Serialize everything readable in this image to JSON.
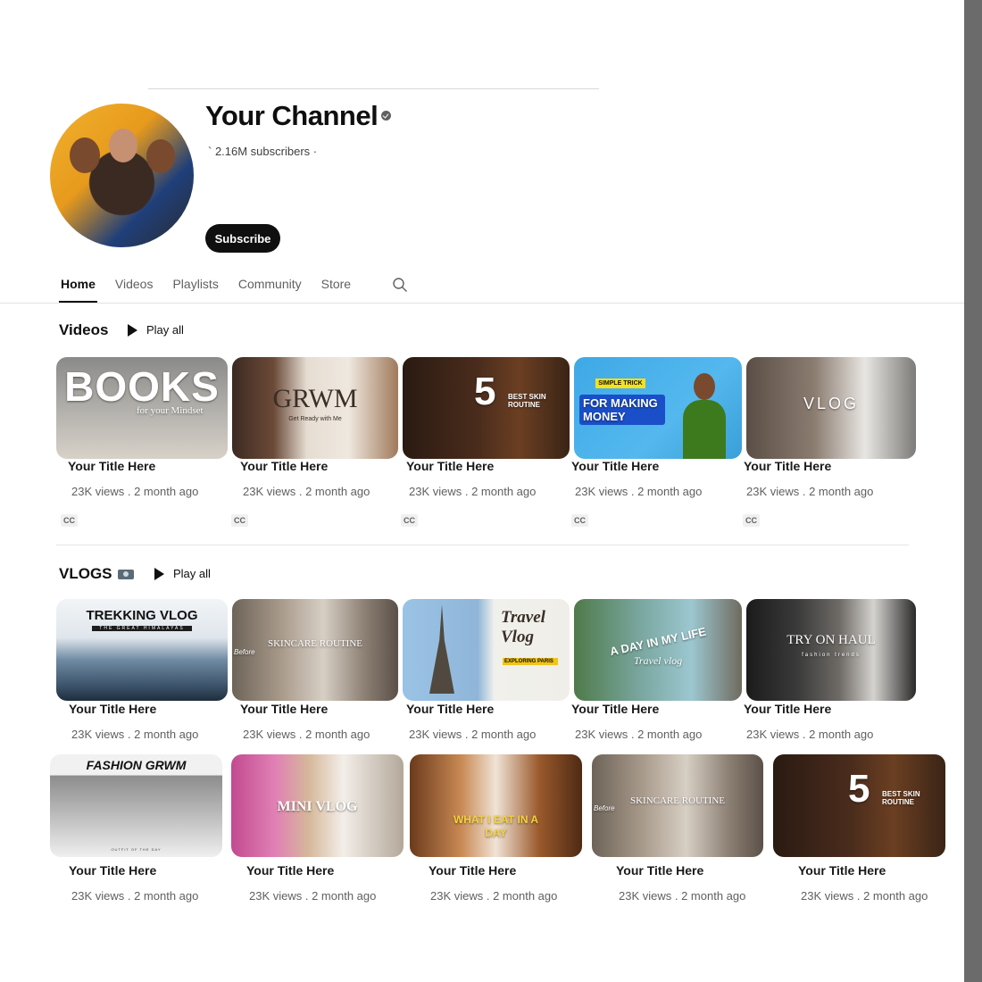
{
  "channel": {
    "name": "Your Channel",
    "subscribers": "` 2.16M subscribers ·",
    "subscribe_label": "Subscribe"
  },
  "tabs": [
    "Home",
    "Videos",
    "Playlists",
    "Community",
    "Store"
  ],
  "icons": {
    "verified": "verified-check-icon",
    "search": "search-icon",
    "play": "play-icon",
    "camera": "camera-icon"
  },
  "colors": {
    "subscribe_bg": "#0f0f0f",
    "side_bar": "#6b6b6b"
  },
  "sections": [
    {
      "title": "Videos",
      "play_all": "Play all",
      "cc": "CC",
      "videos": [
        {
          "thumb_text": "BOOKS",
          "thumb_sub": "for your Mindset",
          "title": "Your Title Here",
          "meta": "23K views . 2 month ago"
        },
        {
          "thumb_text": "GRWM",
          "thumb_sub": "Get Ready with Me",
          "title": "Your Title Here",
          "meta": "23K views . 2 month ago"
        },
        {
          "thumb_text": "5",
          "thumb_sub": "BEST SKIN ROUTINE",
          "title": "Your Title Here",
          "meta": "23K views . 2 month ago"
        },
        {
          "thumb_text": "FOR MAKING MONEY",
          "thumb_sub": "SIMPLE TRICK",
          "title": "Your Title Here",
          "meta": "23K views . 2 month ago"
        },
        {
          "thumb_text": "VLOG",
          "thumb_sub": "",
          "title": "Your Title Here",
          "meta": "23K views . 2 month ago"
        }
      ]
    },
    {
      "title": "VLOGS",
      "play_all": "Play all",
      "videos": [
        {
          "thumb_text": "TREKKING VLOG",
          "thumb_sub": "THE GREAT HIMALAYAS",
          "title": "Your Title Here",
          "meta": "23K views . 2 month ago"
        },
        {
          "thumb_text": "SKINCARE ROUTINE",
          "thumb_sub": "Before",
          "title": "Your Title Here",
          "meta": "23K views . 2 month ago"
        },
        {
          "thumb_text": "Travel Vlog",
          "thumb_sub": "EXPLORING PARIS",
          "title": "Your Title Here",
          "meta": "23K views . 2 month ago"
        },
        {
          "thumb_text": "A DAY IN MY LIFE",
          "thumb_sub": "Travel vlog",
          "title": "Your Title Here",
          "meta": "23K views . 2 month ago"
        },
        {
          "thumb_text": "TRY ON HAUL",
          "thumb_sub": "fashion trends",
          "title": "Your Title Here",
          "meta": "23K views . 2 month ago"
        }
      ]
    },
    {
      "videos": [
        {
          "thumb_text": "FASHION GRWM",
          "thumb_sub": "OUTFIT OF THE DAY",
          "title": "Your Title Here",
          "meta": "23K views . 2 month ago"
        },
        {
          "thumb_text": "MINI VLOG",
          "thumb_sub": "",
          "title": "Your Title Here",
          "meta": "23K views . 2 month ago"
        },
        {
          "thumb_text": "WHAT I EAT IN A DAY",
          "thumb_sub": "",
          "title": "Your Title Here",
          "meta": "23K views . 2 month ago"
        },
        {
          "thumb_text": "SKINCARE ROUTINE",
          "thumb_sub": "Before",
          "title": "Your Title Here",
          "meta": "23K views . 2 month ago"
        },
        {
          "thumb_text": "5",
          "thumb_sub": "BEST SKIN ROUTINE",
          "title": "Your Title Here",
          "meta": "23K views . 2 month ago"
        }
      ]
    }
  ]
}
